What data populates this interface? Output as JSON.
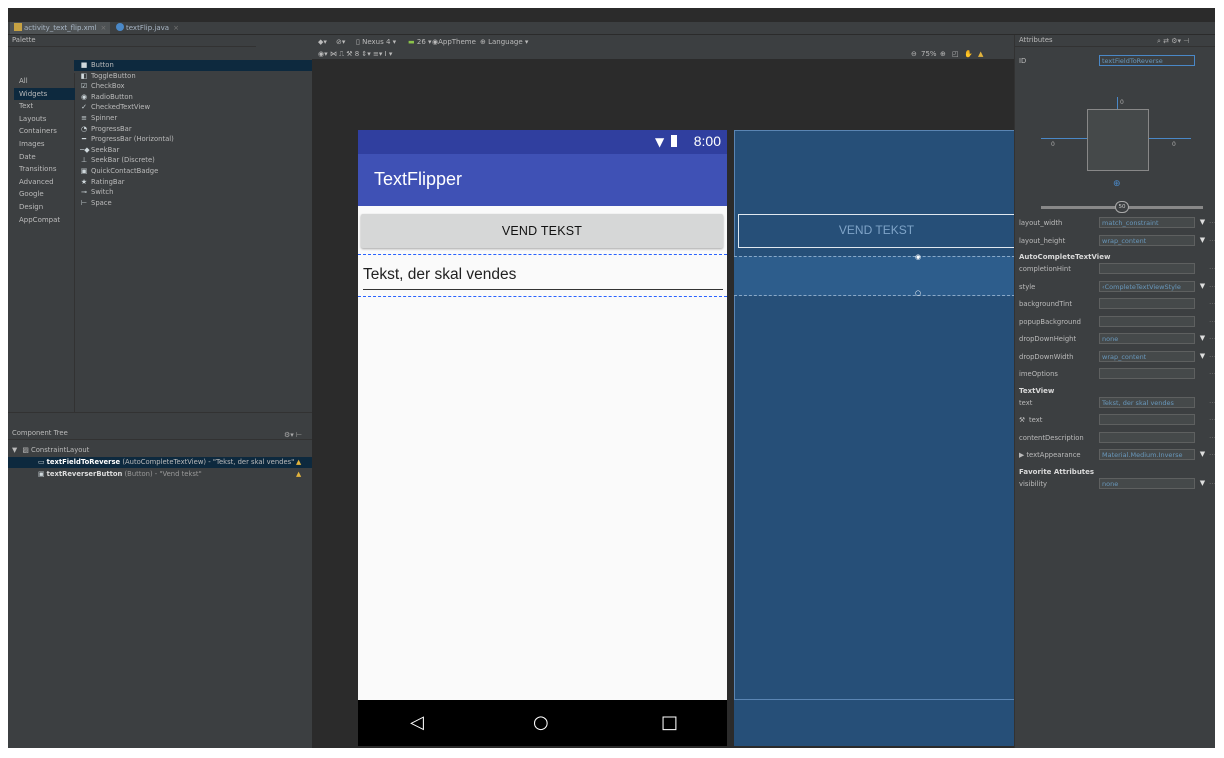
{
  "tabs": [
    {
      "label": "activity_text_flip.xml",
      "active": true
    },
    {
      "label": "textFlip.java",
      "active": false
    }
  ],
  "palette": {
    "title": "Palette",
    "categories": [
      "All",
      "Widgets",
      "Text",
      "Layouts",
      "Containers",
      "Images",
      "Date",
      "Transitions",
      "Advanced",
      "Google",
      "Design",
      "AppCompat"
    ],
    "selected_category": "Widgets",
    "items": [
      {
        "label": "Button",
        "icon": "ok-icon"
      },
      {
        "label": "ToggleButton",
        "icon": "toggle-icon"
      },
      {
        "label": "CheckBox",
        "icon": "checkbox-icon"
      },
      {
        "label": "RadioButton",
        "icon": "radio-icon"
      },
      {
        "label": "CheckedTextView",
        "icon": "checked-text-icon"
      },
      {
        "label": "Spinner",
        "icon": "spinner-icon"
      },
      {
        "label": "ProgressBar",
        "icon": "progress-circle-icon"
      },
      {
        "label": "ProgressBar (Horizontal)",
        "icon": "progress-line-icon"
      },
      {
        "label": "SeekBar",
        "icon": "seekbar-icon"
      },
      {
        "label": "SeekBar (Discrete)",
        "icon": "seekbar-discrete-icon"
      },
      {
        "label": "QuickContactBadge",
        "icon": "contact-icon"
      },
      {
        "label": "RatingBar",
        "icon": "star-icon"
      },
      {
        "label": "Switch",
        "icon": "switch-icon"
      },
      {
        "label": "Space",
        "icon": "space-icon"
      }
    ]
  },
  "toolbar": {
    "device": "Nexus 4",
    "api": "26",
    "theme": "AppTheme",
    "language": "Language",
    "zoom": "75%"
  },
  "component_tree": {
    "title": "Component Tree",
    "root": "ConstraintLayout",
    "children": [
      {
        "id": "textFieldToReverse",
        "desc": "(AutoCompleteTextView) - \"Tekst, der skal vendes\""
      },
      {
        "id": "textReverserButton",
        "desc": "(Button) - \"Vend tekst\""
      }
    ]
  },
  "phone": {
    "time": "8:00",
    "app_title": "TextFlipper",
    "button_label": "VEND TEKST",
    "edit_text": "Tekst, der skal vendes"
  },
  "blueprint": {
    "button_label": "VEND TEKST"
  },
  "attributes": {
    "title": "Attributes",
    "id_label": "ID",
    "id_value": "textFieldToReverse",
    "constraint_values": {
      "top": "0",
      "left": "0",
      "right": "0",
      "bias": "50"
    },
    "rows_top": [
      {
        "label": "layout_width",
        "value": "match_constraint",
        "dd": true
      },
      {
        "label": "layout_height",
        "value": "wrap_content",
        "dd": true
      }
    ],
    "section1": "AutoCompleteTextView",
    "rows_mid": [
      {
        "label": "completionHint",
        "value": "",
        "dd": false
      },
      {
        "label": "style",
        "value": "‹CompleteTextViewStyle",
        "dd": true
      },
      {
        "label": "backgroundTint",
        "value": "",
        "dd": false
      },
      {
        "label": "popupBackground",
        "value": "",
        "dd": false
      },
      {
        "label": "dropDownHeight",
        "value": "none",
        "dd": true
      },
      {
        "label": "dropDownWidth",
        "value": "wrap_content",
        "dd": true
      },
      {
        "label": "imeOptions",
        "value": "",
        "dd": false
      }
    ],
    "section2": "TextView",
    "rows_tv": [
      {
        "label": "text",
        "value": "Tekst, der skal vendes",
        "dd": false
      },
      {
        "label": "text",
        "value": "",
        "dd": false,
        "tool": true
      },
      {
        "label": "contentDescription",
        "value": "",
        "dd": false
      },
      {
        "label": "▶ textAppearance",
        "value": "Material.Medium.Inverse",
        "dd": true
      }
    ],
    "section3": "Favorite Attributes",
    "rows_fav": [
      {
        "label": "visibility",
        "value": "none",
        "dd": true
      }
    ]
  },
  "colors": {
    "primary": "#3f51b5",
    "primary_dark": "#303f9f",
    "blueprint": "#264f78",
    "selection": "#0d293e"
  }
}
